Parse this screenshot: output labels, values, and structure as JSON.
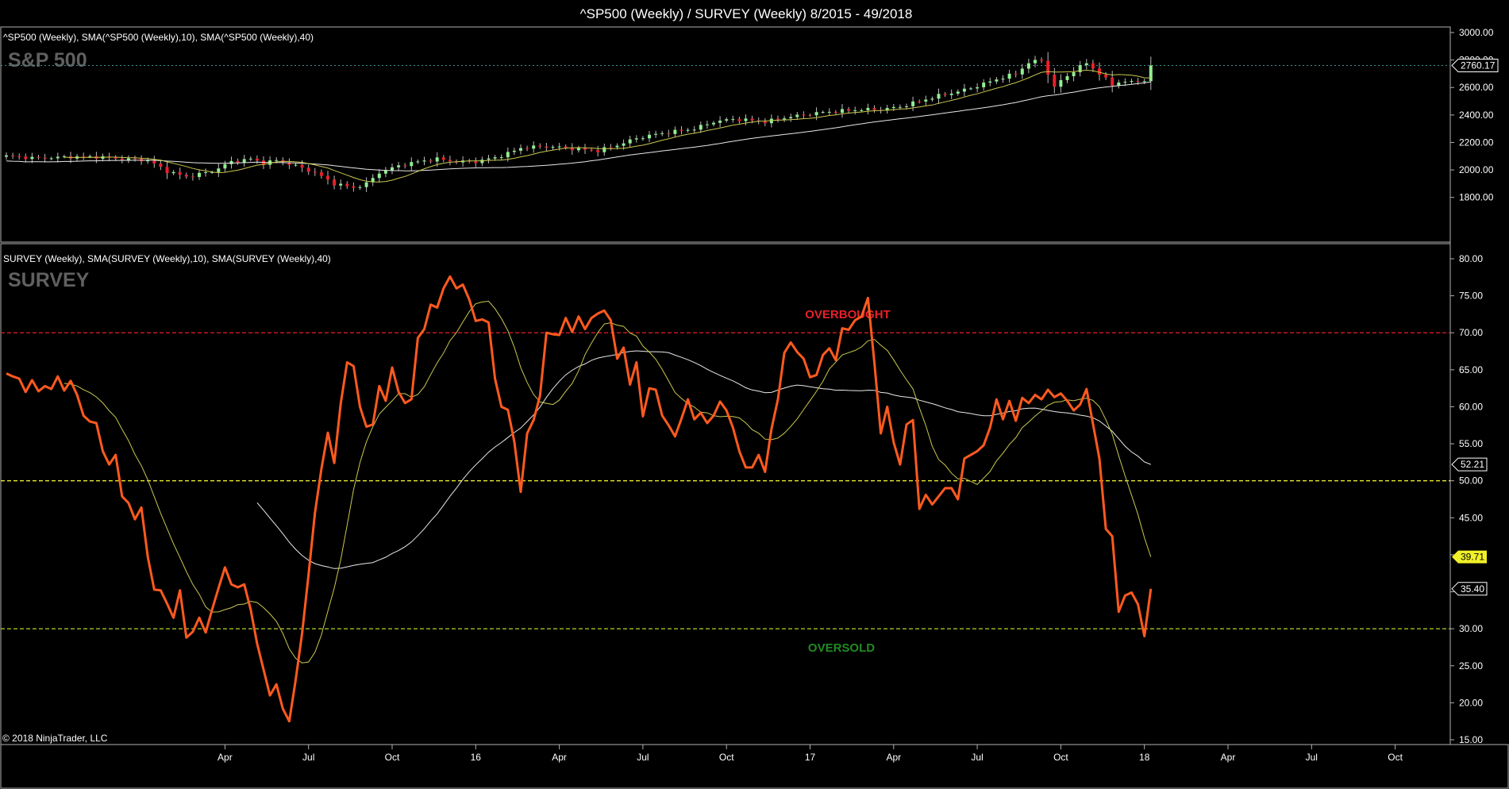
{
  "window": {
    "title": "^SP500 (Weekly) / SURVEY (Weekly)  8/2015 - 49/2018"
  },
  "copyright": "© 2018 NinjaTrader, LLC",
  "colors": {
    "background": "#000000",
    "up_candle": "#90ee90",
    "down_candle": "#e8202a",
    "survey_line": "#ff5a1f",
    "sma10": "#c8c850",
    "sma40": "#e8e8e8",
    "overbought": "#e8202a",
    "fifty": "#e8e830",
    "oversold": "#b4d228",
    "overbought_label": "#e8202a",
    "oversold_label": "#228b22",
    "current_flag": "#f0f028"
  },
  "x_axis": {
    "labels": [
      "Apr",
      "Jul",
      "Oct",
      "16",
      "Apr",
      "Jul",
      "Oct",
      "17",
      "Apr",
      "Jul",
      "Oct",
      "18",
      "Apr",
      "Jul",
      "Oct"
    ],
    "weeks": [
      34,
      47,
      60,
      73,
      86,
      99,
      112,
      125,
      138,
      151,
      164,
      177,
      190,
      203,
      216
    ]
  },
  "sp500_panel": {
    "header": "^SP500 (Weekly),  SMA(^SP500 (Weekly),10),  SMA(^SP500 (Weekly),40)",
    "watermark": "S&P 500",
    "y_ticks": [
      "3000.00",
      "2800.00",
      "2600.00",
      "2400.00",
      "2200.00",
      "2000.00",
      "1800.00"
    ],
    "last_value": "2760.17"
  },
  "survey_panel": {
    "header": "SURVEY (Weekly),  SMA(SURVEY (Weekly),10),  SMA(SURVEY (Weekly),40)",
    "watermark": "SURVEY",
    "y_ticks": [
      "80.00",
      "75.00",
      "70.00",
      "65.00",
      "60.00",
      "55.00",
      "50.00",
      "45.00",
      "40.00",
      "35.00",
      "30.00",
      "25.00",
      "20.00",
      "15.00"
    ],
    "overbought_label": "OVERBOUGHT",
    "oversold_label": "OVERSOLD",
    "badges": {
      "sma40": "52.21",
      "sma10": "39.71",
      "survey": "35.40"
    }
  },
  "chart_data": [
    {
      "type": "candlestick",
      "title": "^SP500 (Weekly),  SMA(^SP500 (Weekly),10),  SMA(^SP500 (Weekly),40)",
      "x_range": [
        "8/2015",
        "49/2018"
      ],
      "ylim": [
        1750,
        3020
      ],
      "close_anchors": [
        [
          0,
          2100
        ],
        [
          5,
          2085
        ],
        [
          10,
          2095
        ],
        [
          14,
          2095
        ],
        [
          18,
          2080
        ],
        [
          22,
          2070
        ],
        [
          25,
          1990
        ],
        [
          28,
          1950
        ],
        [
          32,
          1990
        ],
        [
          35,
          2060
        ],
        [
          38,
          2080
        ],
        [
          40,
          2050
        ],
        [
          42,
          2070
        ],
        [
          45,
          2030
        ],
        [
          48,
          1980
        ],
        [
          51,
          1900
        ],
        [
          54,
          1870
        ],
        [
          56,
          1900
        ],
        [
          58,
          1980
        ],
        [
          61,
          2030
        ],
        [
          64,
          2060
        ],
        [
          67,
          2080
        ],
        [
          70,
          2060
        ],
        [
          73,
          2060
        ],
        [
          76,
          2090
        ],
        [
          78,
          2120
        ],
        [
          80,
          2160
        ],
        [
          83,
          2170
        ],
        [
          86,
          2165
        ],
        [
          89,
          2150
        ],
        [
          92,
          2140
        ],
        [
          95,
          2180
        ],
        [
          98,
          2230
        ],
        [
          101,
          2260
        ],
        [
          104,
          2280
        ],
        [
          107,
          2300
        ],
        [
          110,
          2350
        ],
        [
          113,
          2370
        ],
        [
          116,
          2360
        ],
        [
          118,
          2350
        ],
        [
          121,
          2380
        ],
        [
          124,
          2400
        ],
        [
          127,
          2420
        ],
        [
          130,
          2430
        ],
        [
          133,
          2440
        ],
        [
          136,
          2440
        ],
        [
          139,
          2460
        ],
        [
          142,
          2500
        ],
        [
          145,
          2540
        ],
        [
          148,
          2570
        ],
        [
          151,
          2610
        ],
        [
          154,
          2660
        ],
        [
          157,
          2700
        ],
        [
          159,
          2780
        ],
        [
          161,
          2800
        ],
        [
          163,
          2600
        ],
        [
          164,
          2650
        ],
        [
          166,
          2720
        ],
        [
          168,
          2780
        ],
        [
          170,
          2700
        ],
        [
          172,
          2620
        ],
        [
          173,
          2640
        ],
        [
          175,
          2640
        ],
        [
          178,
          2660
        ],
        [
          181,
          2700
        ],
        [
          184,
          2720
        ],
        [
          187,
          2740
        ],
        [
          190,
          2760
        ],
        [
          193,
          2800
        ],
        [
          196,
          2850
        ],
        [
          199,
          2890
        ],
        [
          202,
          2910
        ],
        [
          205,
          2880
        ],
        [
          206,
          2780
        ],
        [
          208,
          2720
        ],
        [
          210,
          2700
        ],
        [
          212,
          2760
        ],
        [
          213,
          2690
        ],
        [
          215,
          2640
        ],
        [
          216,
          2760
        ]
      ],
      "sma10_last": 2780,
      "sma40_last": 2780,
      "last_close": 2760.17
    },
    {
      "type": "line",
      "title": "SURVEY (Weekly),  SMA(SURVEY (Weekly),10),  SMA(SURVEY (Weekly),40)",
      "x_range": [
        "8/2015",
        "49/2018"
      ],
      "ylim": [
        15,
        81
      ],
      "reference_lines": [
        {
          "name": "OVERBOUGHT",
          "value": 70
        },
        {
          "value": 50
        },
        {
          "name": "OVERSOLD",
          "value": 30
        }
      ],
      "values": [
        64.5,
        64.1,
        63.8,
        62.0,
        63.6,
        62.1,
        62.8,
        62.4,
        64.1,
        62.2,
        63.5,
        61.6,
        58.8,
        58.0,
        57.8,
        54.0,
        52.2,
        53.5,
        47.9,
        47.0,
        44.8,
        46.4,
        39.7,
        35.3,
        35.2,
        33.4,
        31.5,
        35.2,
        28.8,
        29.6,
        31.5,
        29.5,
        32.6,
        35.5,
        38.3,
        36.0,
        35.6,
        36.0,
        32.6,
        28.0,
        24.5,
        21.0,
        22.5,
        19.2,
        17.5,
        23.1,
        29.4,
        37.3,
        45.7,
        51.6,
        56.5,
        52.4,
        60.4,
        66.0,
        65.5,
        60.0,
        57.3,
        57.6,
        62.8,
        60.8,
        65.3,
        62.0,
        60.5,
        61.0,
        69.3,
        70.5,
        73.8,
        73.4,
        76.0,
        77.6,
        76.0,
        76.5,
        74.5,
        71.6,
        71.8,
        71.4,
        63.8,
        60.0,
        59.6,
        55.3,
        48.5,
        56.4,
        58.2,
        61.5,
        70.0,
        69.8,
        69.7,
        72.0,
        70.1,
        72.2,
        70.5,
        72.0,
        72.6,
        73.0,
        71.7,
        66.5,
        68.0,
        63.0,
        66.0,
        58.7,
        62.5,
        62.3,
        58.8,
        57.5,
        56.0,
        58.4,
        61.0,
        58.3,
        59.2,
        57.8,
        58.8,
        60.7,
        59.5,
        57.2,
        54.0,
        51.8,
        51.8,
        53.5,
        51.2,
        57.0,
        61.0,
        67.3,
        68.7,
        67.4,
        66.5,
        64.0,
        64.3,
        67.0,
        67.9,
        66.3,
        70.6,
        70.4,
        71.7,
        72.2,
        74.7,
        66.0,
        56.4,
        60.0,
        55.2,
        52.2,
        57.6,
        58.2,
        46.2,
        48.1,
        46.8,
        47.9,
        49.0,
        49.0,
        47.5,
        53.0,
        53.5,
        54.0,
        54.8,
        57.2,
        61.0,
        58.3,
        60.8,
        58.1,
        61.2,
        60.5,
        61.6,
        61.0,
        62.3,
        61.3,
        61.8,
        60.8,
        59.5,
        60.3,
        62.4,
        57.7,
        53.0,
        43.5,
        42.5,
        32.3,
        34.5,
        34.9,
        33.3,
        29.0,
        35.4
      ],
      "series": [
        {
          "key": "survey",
          "last": 35.4
        },
        {
          "key": "sma10",
          "last": 39.71
        },
        {
          "key": "sma40",
          "last": 52.21
        }
      ]
    }
  ]
}
